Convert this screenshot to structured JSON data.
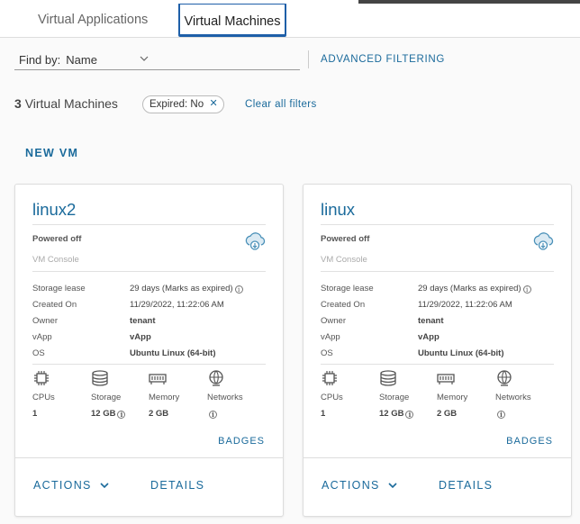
{
  "tabs": [
    {
      "label": "Virtual Applications"
    },
    {
      "label": "Virtual Machines"
    }
  ],
  "filter": {
    "find_by_label": "Find by:",
    "find_by_value": "Name",
    "advanced_label": "ADVANCED FILTERING",
    "count": "3",
    "count_label": "Virtual Machines",
    "chip_label": "Expired:",
    "chip_value": "No",
    "clear_label": "Clear all filters"
  },
  "new_vm_label": "NEW VM",
  "prop_labels": {
    "storage_lease": "Storage lease",
    "created_on": "Created On",
    "owner": "Owner",
    "vapp": "vApp",
    "os": "OS"
  },
  "res_labels": {
    "cpus": "CPUs",
    "storage": "Storage",
    "memory": "Memory",
    "networks": "Networks"
  },
  "cards": [
    {
      "name": "linux2",
      "status": "Powered off",
      "console": "VM Console",
      "storage_lease": "29 days (Marks as expired)",
      "created_on": "11/29/2022, 11:22:06 AM",
      "owner": "tenant",
      "vapp": "vApp",
      "os": "Ubuntu Linux (64-bit)",
      "cpus": "1",
      "storage": "12 GB",
      "memory": "2 GB",
      "badges": "BADGES",
      "actions": "ACTIONS",
      "details": "DETAILS"
    },
    {
      "name": "linux",
      "status": "Powered off",
      "console": "VM Console",
      "storage_lease": "29 days (Marks as expired)",
      "created_on": "11/29/2022, 11:22:06 AM",
      "owner": "tenant",
      "vapp": "vApp",
      "os": "Ubuntu Linux (64-bit)",
      "cpus": "1",
      "storage": "12 GB",
      "memory": "2 GB",
      "badges": "BADGES",
      "actions": "ACTIONS",
      "details": "DETAILS"
    }
  ],
  "colors": {
    "accent": "#1a6a9b",
    "tab_active_border": "#1e5fa8"
  },
  "icons": [
    "chevron-down-icon",
    "close-icon",
    "cloud-download-icon",
    "info-icon",
    "cpu-icon",
    "storage-icon",
    "memory-icon",
    "network-icon"
  ]
}
